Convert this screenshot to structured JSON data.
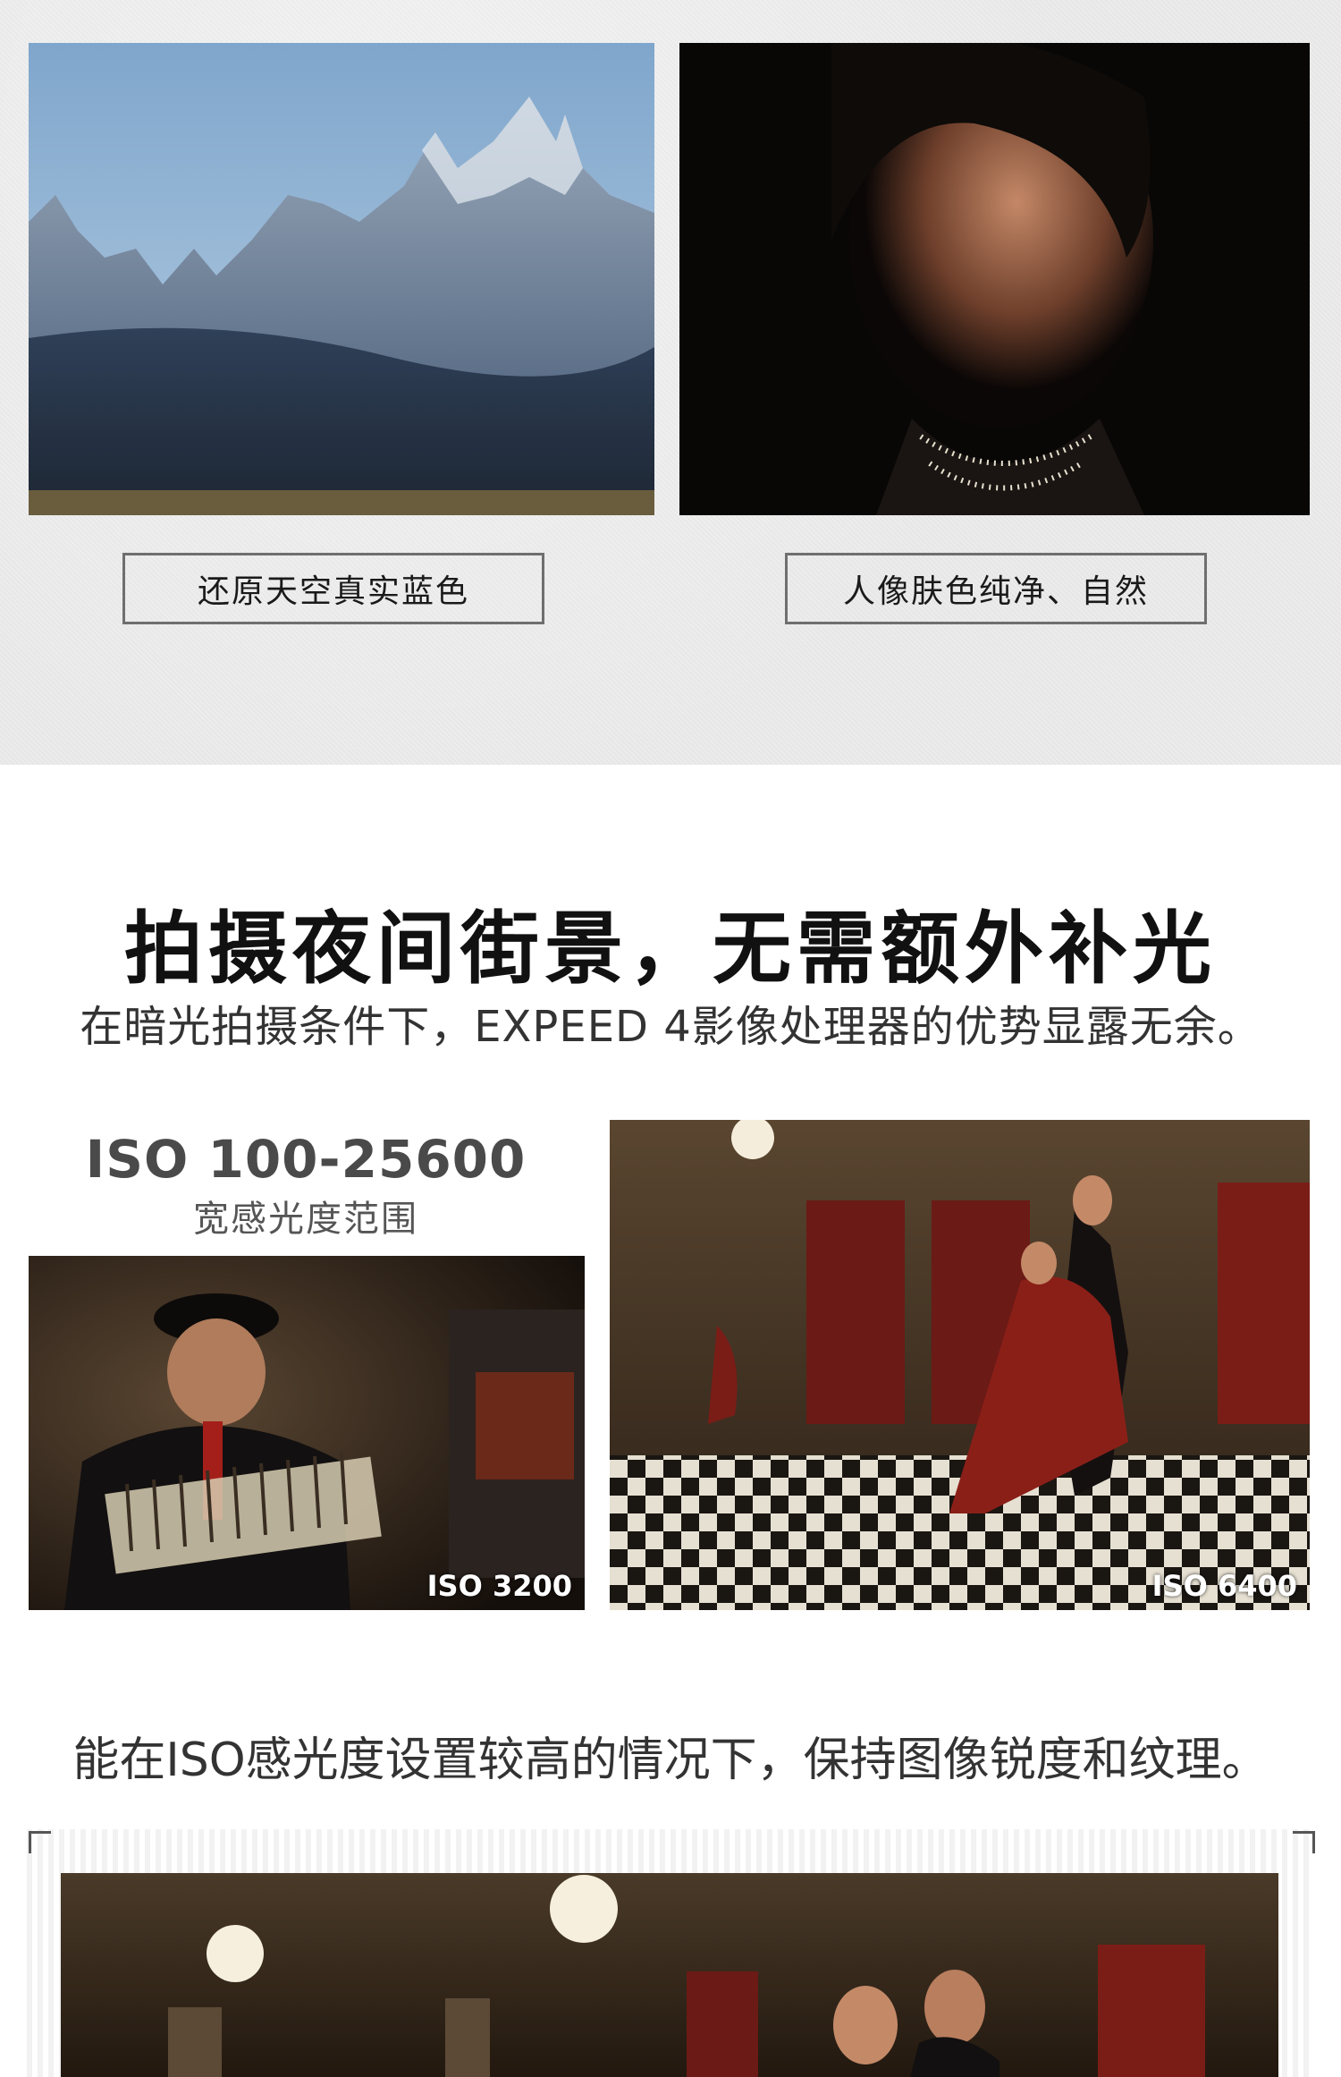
{
  "section_top": {
    "landscape_caption": "还原天空真实蓝色",
    "portrait_caption": "人像肤色纯净、自然"
  },
  "section_night": {
    "heading": "拍摄夜间街景，无需额外补光",
    "subheading": "在暗光拍摄条件下，EXPEED 4影像处理器的优势显露无余。",
    "iso_range": "ISO 100-25600",
    "iso_range_label": "宽感光度范围",
    "photo_left_iso": "ISO 3200",
    "photo_right_iso": "ISO 6400",
    "note": "能在ISO感光度设置较高的情况下，保持图像锐度和纹理。"
  },
  "colors": {
    "section_bg": "#e9e9e9",
    "caption_border": "#6f6f6f",
    "heading": "#111111"
  }
}
